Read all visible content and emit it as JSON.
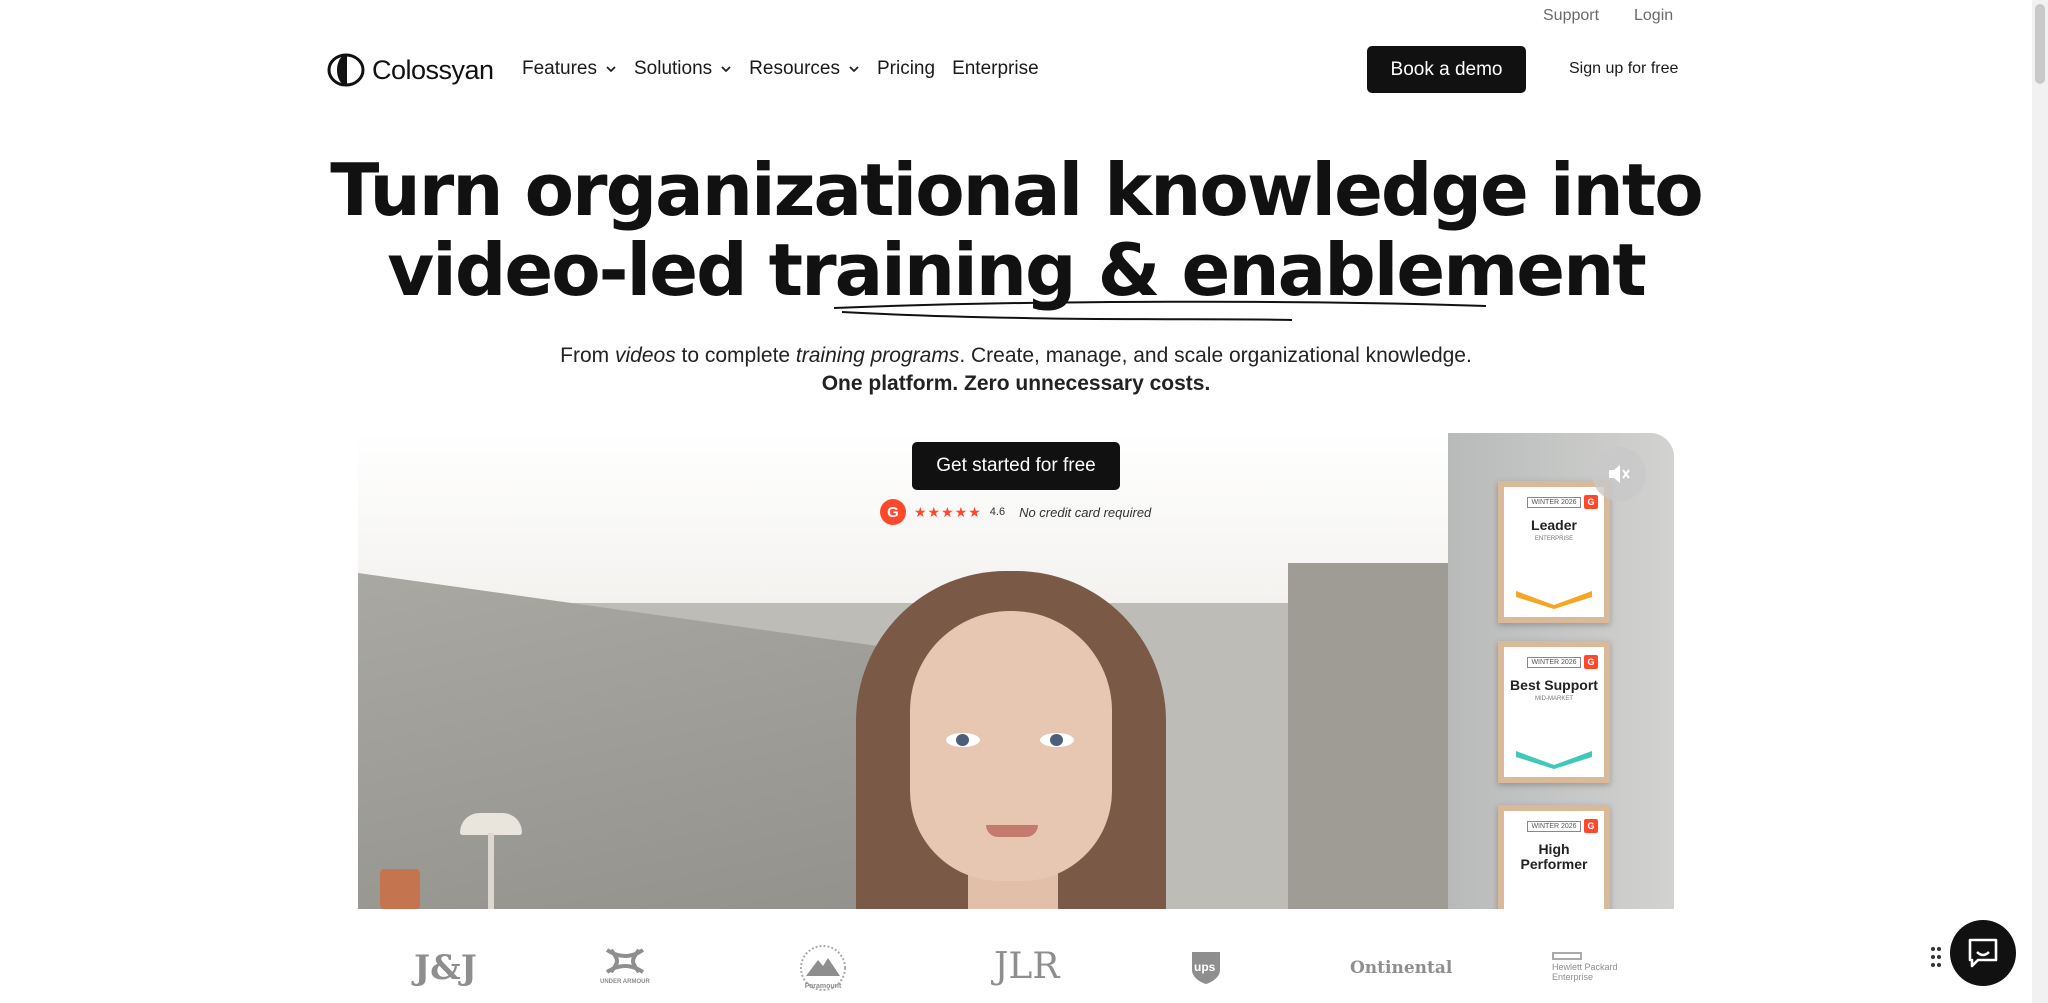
{
  "utility": {
    "support": "Support",
    "login": "Login"
  },
  "brand": {
    "name": "Colossyan"
  },
  "nav": {
    "features": "Features",
    "solutions": "Solutions",
    "resources": "Resources",
    "pricing": "Pricing",
    "enterprise": "Enterprise"
  },
  "cta": {
    "book_demo": "Book a demo",
    "sign_up": "Sign up for free",
    "get_started": "Get started for free"
  },
  "hero": {
    "line1": "Turn organizational knowledge into",
    "line2": "video-led training & enablement",
    "sub_from": "From ",
    "sub_videos": "videos",
    "sub_mid": " to complete ",
    "sub_programs": "training programs",
    "sub_end": ". Create, manage, and scale organizational knowledge.",
    "sub2": "One platform. Zero unnecessary costs."
  },
  "rating": {
    "g2": "G",
    "stars": "★★★★★",
    "score": "4.6",
    "note": "No credit card required"
  },
  "badges": [
    {
      "season": "WINTER 2026",
      "title": "Leader",
      "segment": "ENTERPRISE"
    },
    {
      "season": "WINTER 2026",
      "title": "Best Support",
      "segment": "MID-MARKET"
    },
    {
      "season": "WINTER 2026",
      "title": "High Performer",
      "segment": ""
    }
  ],
  "logos": [
    "J&J",
    "UNDER ARMOUR",
    "Paramount",
    "JLR",
    "ups",
    "Ontinental",
    "Hewlett Packard Enterprise"
  ],
  "colors": {
    "primary": "#111111",
    "g2_red": "#ff492c"
  }
}
